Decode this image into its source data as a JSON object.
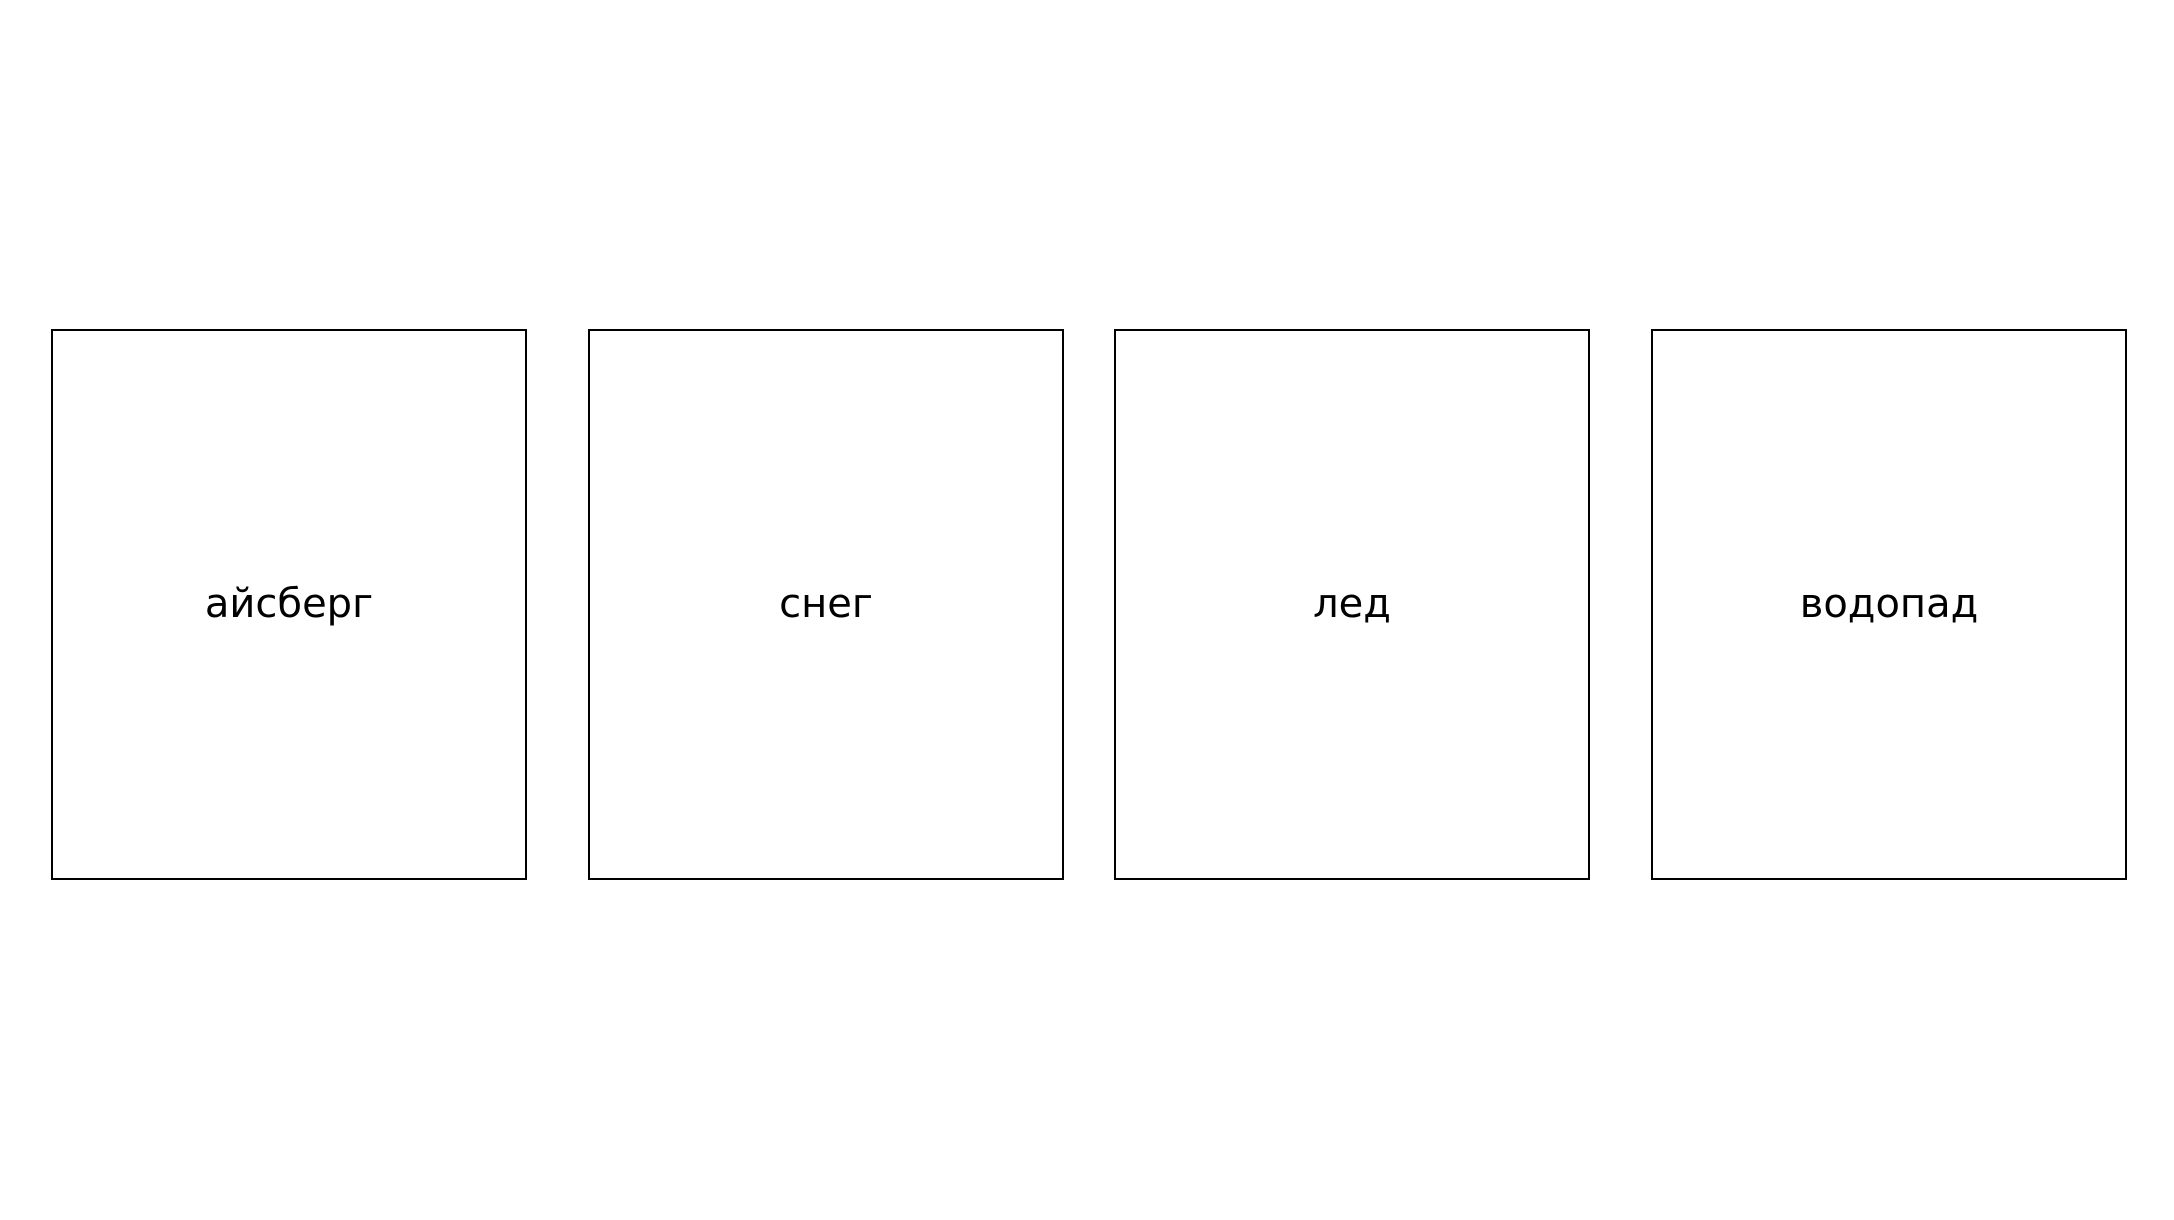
{
  "cards": [
    {
      "label": "айсберг"
    },
    {
      "label": "снег"
    },
    {
      "label": "лед"
    },
    {
      "label": "водопад"
    }
  ],
  "colors": {
    "background": "#ffffff",
    "border": "#000000",
    "text": "#000000"
  }
}
